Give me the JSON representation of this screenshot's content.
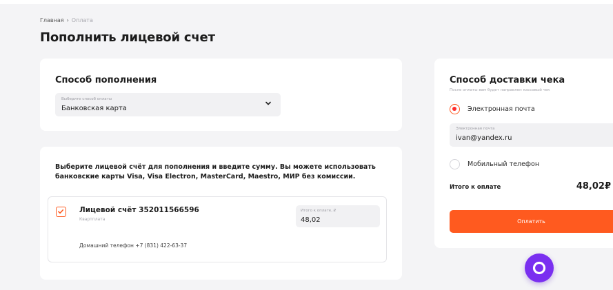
{
  "breadcrumb": {
    "home": "Главная",
    "current": "Оплата"
  },
  "page": {
    "title": "Пополнить лицевой счет"
  },
  "payment_method": {
    "title": "Способ пополнения",
    "select_placeholder": "Выберите способ оплаты",
    "select_value": "Банковская карта"
  },
  "account": {
    "description": "Выберите лицевой счёт для пополнения и введите сумму. Вы можете использовать банковские карты Visa, Visa Electron, MasterCard, Maestro, МИР без комиссии.",
    "checked": true,
    "name": "Лицевой счёт 352011566596",
    "subtitle": "Квартплата",
    "amount_placeholder": "Итого к оплате, ₽",
    "amount_value": "48,02",
    "home_phone": "Домашний телефон +7 (831) 422-63-37"
  },
  "receipt": {
    "title": "Способ доставки чека",
    "hint": "После оплаты вам будет направлен кассовый чек",
    "option_email": "Электронная почта",
    "email_placeholder": "Электронная почта",
    "email_value": "ivan@yandex.ru",
    "option_phone": "Мобильный телефон",
    "selected": "email",
    "total_label": "Итого к оплате",
    "total_value": "48,02₽",
    "pay_button": "Оплатить"
  },
  "icons": {
    "breadcrumb_sep": "chevron-right-icon",
    "select": "chevron-down-icon",
    "checkbox": "checkmark-icon",
    "chat": "chat-bubble-icon"
  },
  "colors": {
    "accent": "#ff5a1f",
    "radio_dot": "#ff2d2d",
    "chat": "#7a2ff0",
    "background": "#f4f4f6"
  }
}
